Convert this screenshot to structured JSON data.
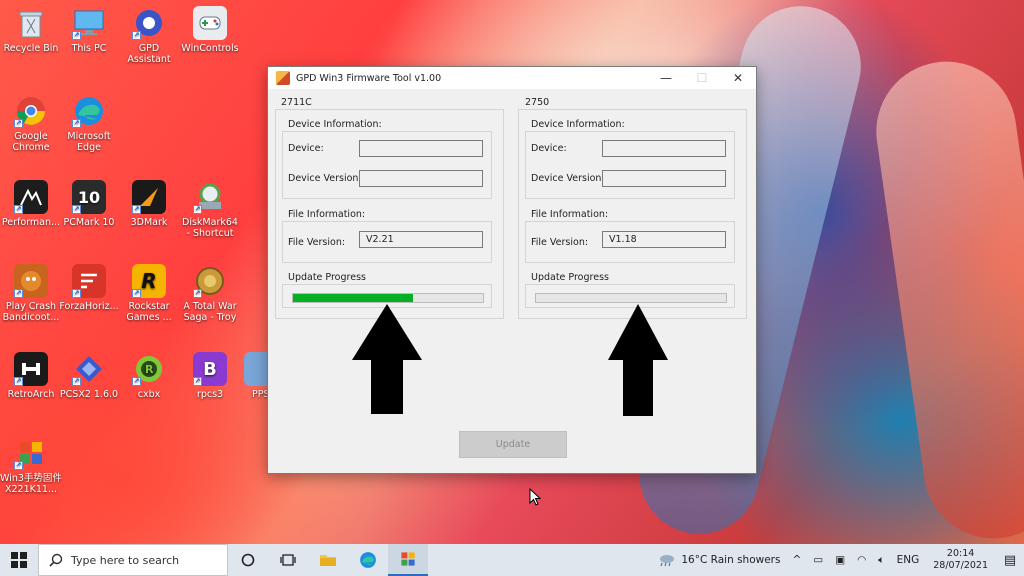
{
  "desktop": {
    "icons": [
      {
        "label": "Recycle Bin"
      },
      {
        "label": "This PC"
      },
      {
        "label": "GPD Assistant"
      },
      {
        "label": "WinControls"
      },
      {
        "label": "Google Chrome"
      },
      {
        "label": "Microsoft Edge"
      },
      {
        "label": "Performan..."
      },
      {
        "label": "PCMark 10"
      },
      {
        "label": "3DMark"
      },
      {
        "label": "DiskMark64 - Shortcut"
      },
      {
        "label": "Play Crash Bandicoot..."
      },
      {
        "label": "ForzaHoriz..."
      },
      {
        "label": "Rockstar Games ..."
      },
      {
        "label": "A Total War Saga - Troy"
      },
      {
        "label": "RetroArch"
      },
      {
        "label": "PCSX2 1.6.0"
      },
      {
        "label": "cxbx"
      },
      {
        "label": "rpcs3"
      },
      {
        "label": "PPS"
      },
      {
        "label": "Win3手势固件X221K11..."
      }
    ]
  },
  "window": {
    "title": "GPD Win3 Firmware Tool v1.00",
    "left_panel": {
      "title": "2711C",
      "device_info_label": "Device Information:",
      "device_label": "Device:",
      "device_value": "",
      "device_version_label": "Device Version:",
      "device_version_value": "",
      "file_info_label": "File Information:",
      "file_version_label": "File Version:",
      "file_version_value": "V2.21",
      "update_progress_label": "Update Progress",
      "progress_fraction": 0.63
    },
    "right_panel": {
      "title": "2750",
      "device_info_label": "Device Information:",
      "device_label": "Device:",
      "device_value": "",
      "device_version_label": "Device Version:",
      "device_version_value": "",
      "file_info_label": "File Information:",
      "file_version_label": "File Version:",
      "file_version_value": "V1.18",
      "update_progress_label": "Update Progress",
      "progress_fraction": 0.0
    },
    "update_button_label": "Update"
  },
  "taskbar": {
    "search_placeholder": "Type here to search",
    "weather": "16°C  Rain showers",
    "language": "ENG",
    "time": "20:14",
    "date": "28/07/2021"
  },
  "colors": {
    "progress_fill": "#06b025",
    "arrow": "#000000"
  }
}
